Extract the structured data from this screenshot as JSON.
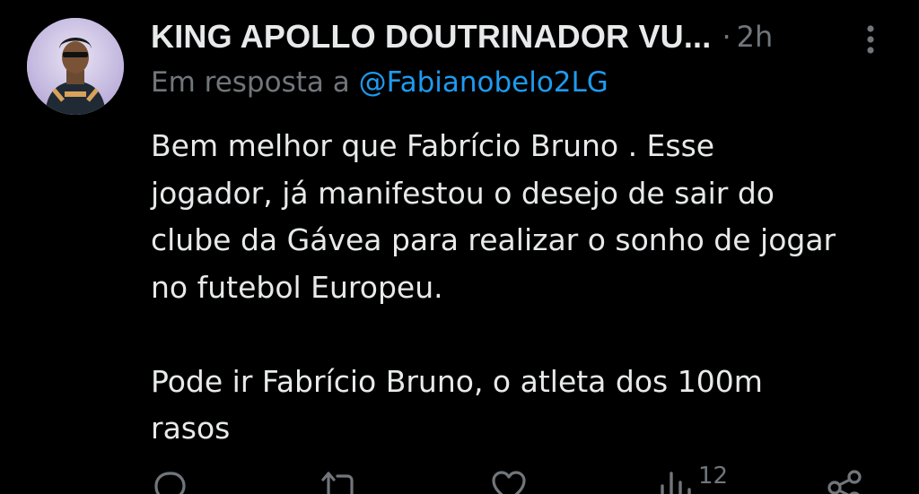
{
  "post": {
    "display_name": "KING APOLLO DOUTRINADOR VU...",
    "separator": "·",
    "time": "2h",
    "reply_prefix": "Em resposta a",
    "reply_handle": "@Fabianobelo2LG",
    "body_lines": [
      "Bem melhor que Fabrício Bruno . Esse",
      "jogador, já manifestou o desejo de sair do",
      "clube da Gávea para realizar o sonho de jogar",
      "no futebol Europeu.",
      "",
      "Pode ir Fabrício Bruno, o atleta dos 100m",
      "rasos"
    ]
  },
  "actions": {
    "reply": {
      "icon": "reply-icon"
    },
    "repost": {
      "icon": "repost-icon"
    },
    "like": {
      "icon": "like-icon"
    },
    "views": {
      "icon": "views-icon",
      "count": "12"
    },
    "share": {
      "icon": "share-icon"
    }
  },
  "colors": {
    "background": "#000000",
    "text_primary": "#e7e9ea",
    "text_secondary": "#71767b",
    "accent": "#1d9bf0"
  }
}
